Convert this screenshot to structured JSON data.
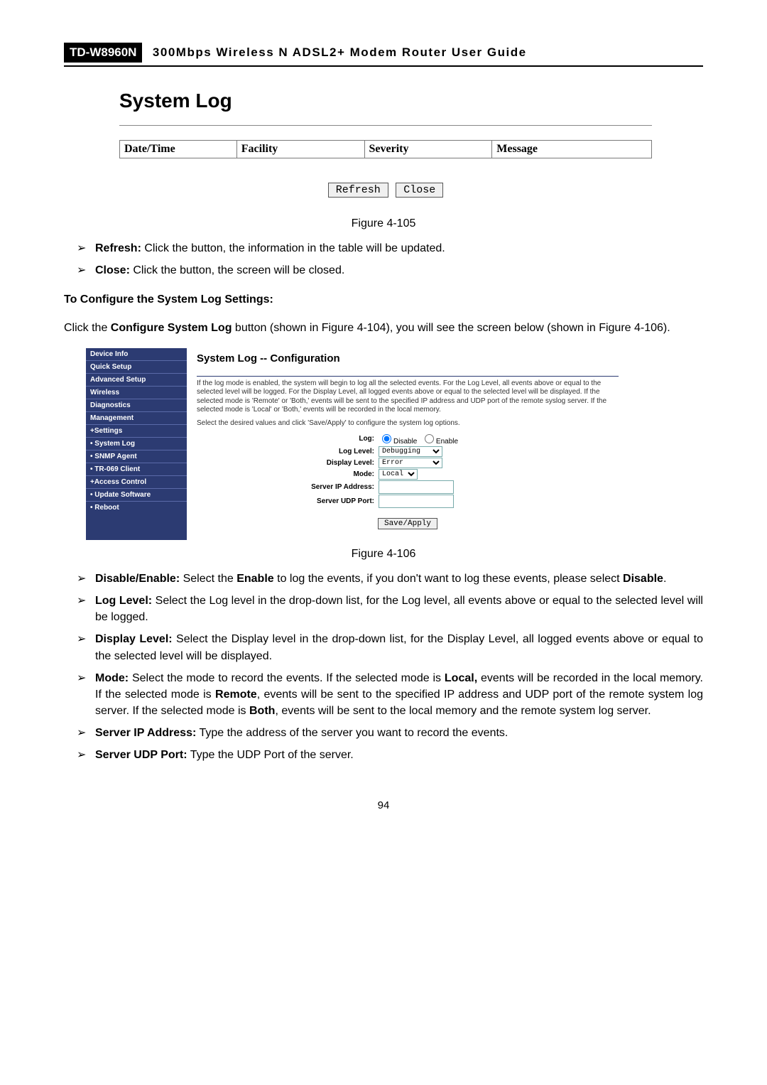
{
  "header": {
    "model": "TD-W8960N",
    "title": "300Mbps  Wireless  N  ADSL2+  Modem  Router  User  Guide"
  },
  "fig105": {
    "heading": "System Log",
    "cols": [
      "Date/Time",
      "Facility",
      "Severity",
      "Message"
    ],
    "refresh": "Refresh",
    "close": "Close",
    "caption": "Figure 4-105"
  },
  "bullets1": {
    "refresh_label": "Refresh:",
    "refresh_text": " Click the button, the information in the table will be updated.",
    "close_label": "Close:",
    "close_text": " Click the button, the screen will be closed."
  },
  "section1_heading": "To Configure the System Log Settings:",
  "section1_para_a": "Click the ",
  "section1_para_b": "Configure System Log",
  "section1_para_c": " button (shown in Figure 4-104), you will see the screen below (shown in Figure 4-106).",
  "fig106": {
    "caption": "Figure 4-106",
    "nav": {
      "device_info": "Device Info",
      "quick_setup": "Quick Setup",
      "advanced_setup": "Advanced Setup",
      "wireless": "Wireless",
      "diagnostics": "Diagnostics",
      "management": "Management",
      "settings": "+Settings",
      "system_log": "• System Log",
      "snmp_agent": "• SNMP Agent",
      "tr069": "• TR-069 Client",
      "access_control": "+Access Control",
      "update_software": "• Update Software",
      "reboot": "• Reboot"
    },
    "main": {
      "title": "System Log -- Configuration",
      "desc": "If the log mode is enabled, the system will begin to log all the selected events. For the Log Level, all events above or equal to the selected level will be logged. For the Display Level, all logged events above or equal to the selected level will be displayed. If the selected mode is 'Remote' or 'Both,' events will be sent to the specified IP address and UDP port of the remote syslog server. If the selected mode is 'Local' or 'Both,' events will be recorded in the local memory.",
      "instr": "Select the desired values and click 'Save/Apply' to configure the system log options.",
      "lbl_log": "Log:",
      "radio_disable": "Disable",
      "radio_enable": "Enable",
      "lbl_loglevel": "Log Level:",
      "val_loglevel": "Debugging",
      "lbl_displevel": "Display Level:",
      "val_displevel": "Error",
      "lbl_mode": "Mode:",
      "val_mode": "Local",
      "lbl_serverip": "Server IP Address:",
      "lbl_serverport": "Server UDP Port:",
      "apply": "Save/Apply"
    }
  },
  "bullets2": {
    "de_label": "Disable/Enable:",
    "de_texta": " Select the ",
    "de_textb": "Enable",
    "de_textc": " to log the events, if you don't want to log these events, please select ",
    "de_textd": "Disable",
    "de_texte": ".",
    "ll_label": "Log Level:",
    "ll_text": " Select the Log level in the drop-down list, for the Log level, all events above or equal to the selected level will be logged.",
    "dl_label": "Display Level:",
    "dl_text": " Select the Display level in the drop-down list, for the Display Level, all logged events above or equal to the selected level will be displayed.",
    "mode_label": "Mode:",
    "mode_a": " Select the mode to record the events. If the selected mode is ",
    "mode_b": "Local,",
    "mode_c": " events will be recorded in the local memory. If the selected mode is ",
    "mode_d": "Remote",
    "mode_e": ", events will be sent to the specified IP address and UDP port of the remote system log server. If the selected mode is ",
    "mode_f": "Both",
    "mode_g": ", events will be sent to the local memory and the remote system log server.",
    "sip_label": "Server IP Address:",
    "sip_text": " Type the address of the server you want to record the events.",
    "sport_label": "Server UDP Port:",
    "sport_text": " Type the UDP Port of the server."
  },
  "page_number": "94"
}
